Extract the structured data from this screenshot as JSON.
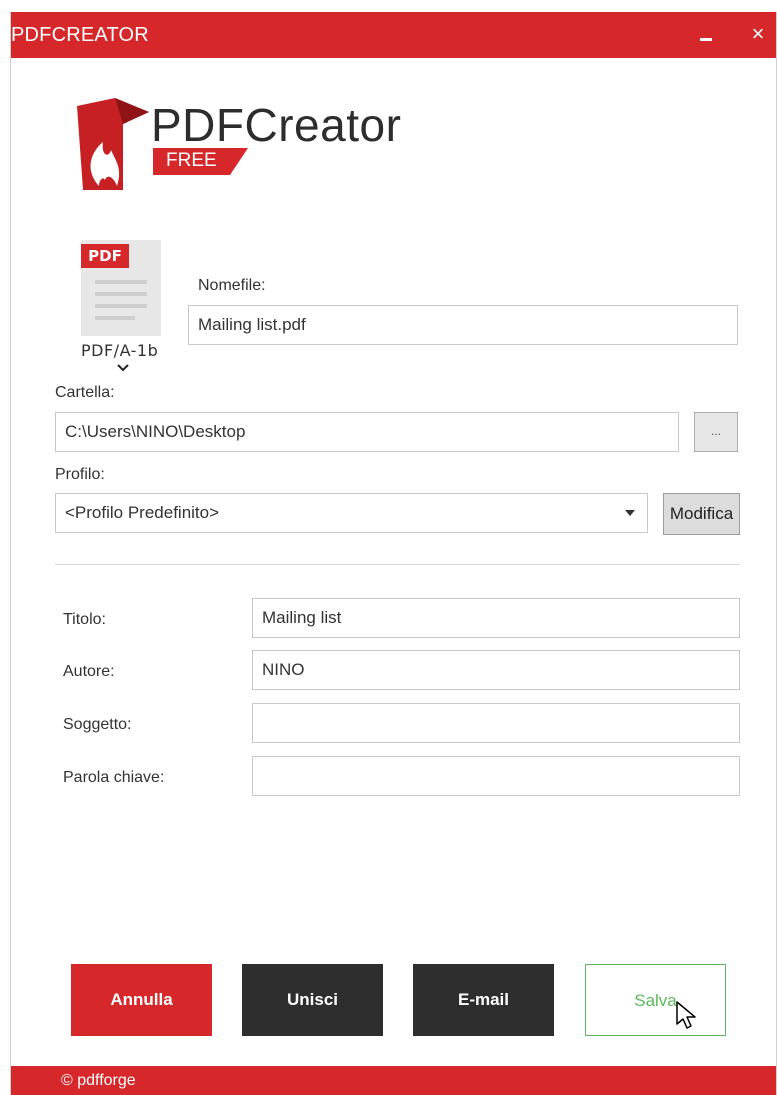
{
  "window": {
    "title": "PDFCREATOR",
    "minimize_icon": "minimize-icon",
    "close_label": "×"
  },
  "brand": {
    "name": "PDFCreator",
    "badge": "FREE",
    "logo_icon": "pdfcreator-flame-logo"
  },
  "format": {
    "tag": "PDF",
    "label": "PDF/A-1b",
    "icon": "pdf-document-icon"
  },
  "form": {
    "filename_label": "Nomefile:",
    "filename_value": "Mailing list.pdf",
    "folder_label": "Cartella:",
    "folder_value": "C:\\Users\\NINO\\Desktop",
    "browse_label": "...",
    "profile_label": "Profilo:",
    "profile_value": "<Profilo Predefinito>",
    "modify_label": "Modifica"
  },
  "metadata": {
    "title_label": "Titolo:",
    "title_value": "Mailing list",
    "author_label": "Autore:",
    "author_value": "NINO",
    "subject_label": "Soggetto:",
    "subject_value": "",
    "keywords_label": "Parola chiave:",
    "keywords_value": ""
  },
  "actions": {
    "cancel": "Annulla",
    "merge": "Unisci",
    "email": "E-mail",
    "save": "Salva"
  },
  "footer": {
    "copyright": "© pdfforge"
  },
  "colors": {
    "brand_red": "#d6282b",
    "dark_button": "#2e2e2e",
    "save_green": "#5cb85c"
  }
}
